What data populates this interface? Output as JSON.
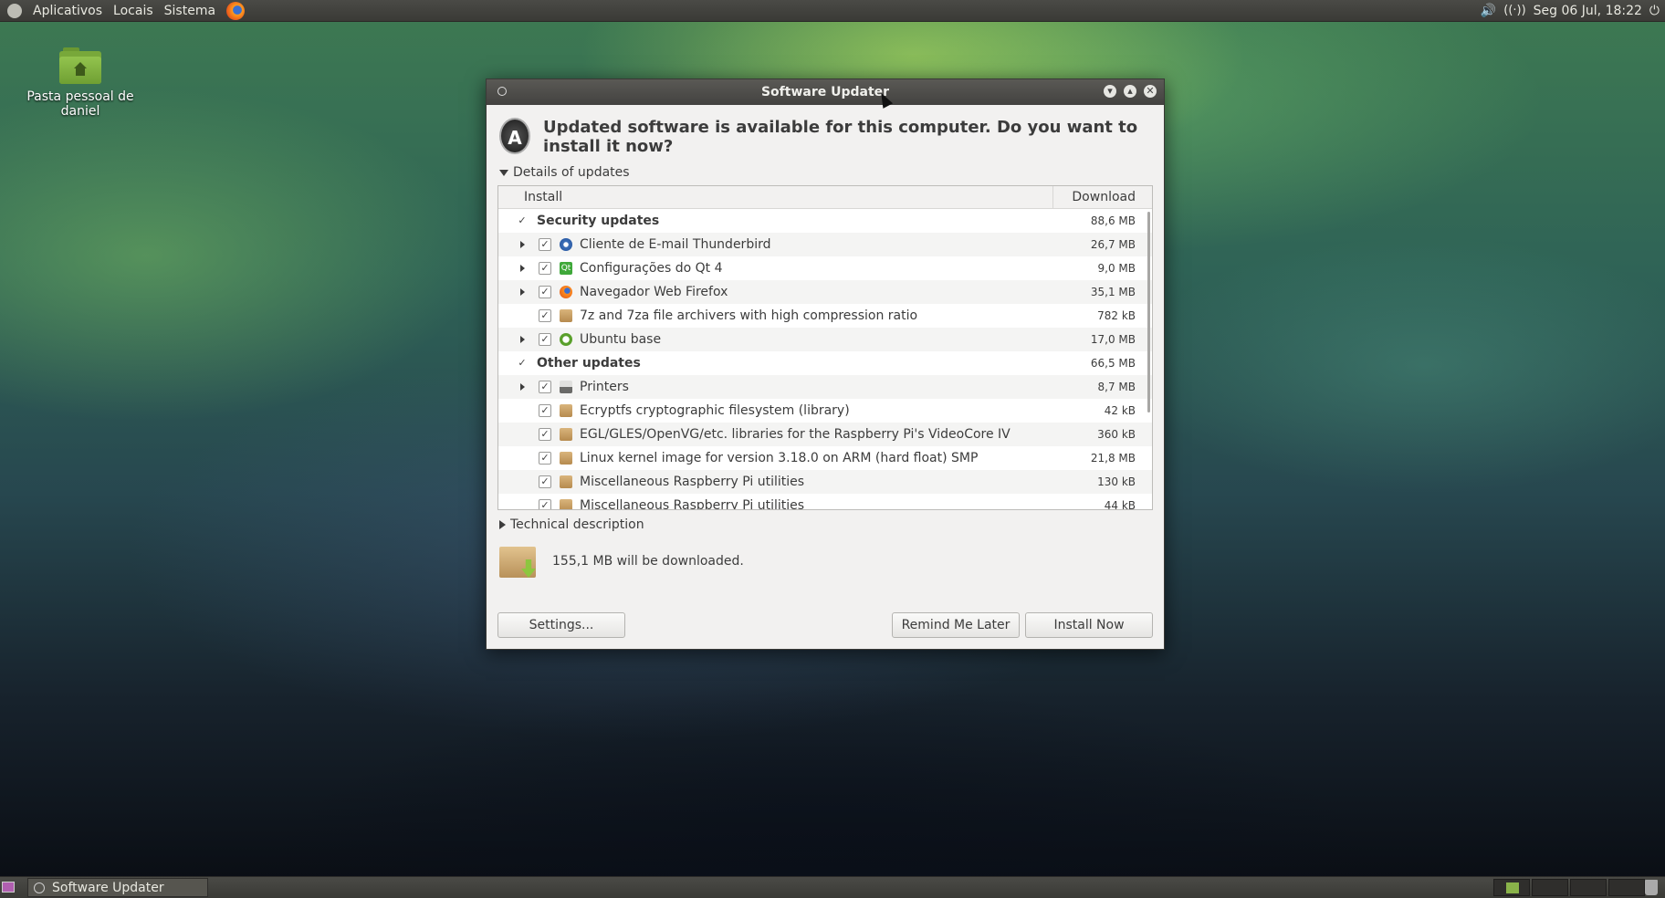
{
  "top_panel": {
    "menus": [
      "Aplicativos",
      "Locais",
      "Sistema"
    ],
    "clock": "Seg 06 Jul, 18:22"
  },
  "desktop": {
    "home_icon_label": "Pasta pessoal de daniel"
  },
  "window": {
    "title": "Software Updater",
    "headline": "Updated software is available for this computer. Do you want to install it now?",
    "details_label": "Details of updates",
    "columns": {
      "install": "Install",
      "download": "Download"
    },
    "rows": [
      {
        "kind": "category",
        "label": "Security updates",
        "size": "88,6 MB",
        "checked": true,
        "expandable": false,
        "icon": ""
      },
      {
        "kind": "item",
        "label": "Cliente de E-mail Thunderbird",
        "size": "26,7 MB",
        "checked": true,
        "expandable": true,
        "icon": "thunderbird-icon"
      },
      {
        "kind": "item",
        "label": "Configurações do Qt 4",
        "size": "9,0 MB",
        "checked": true,
        "expandable": true,
        "icon": "qt-icon"
      },
      {
        "kind": "item",
        "label": "Navegador Web Firefox",
        "size": "35,1 MB",
        "checked": true,
        "expandable": true,
        "icon": "firefox-icon"
      },
      {
        "kind": "item",
        "label": "7z and 7za file archivers with high compression ratio",
        "size": "782 kB",
        "checked": true,
        "expandable": false,
        "icon": "package-icon"
      },
      {
        "kind": "item",
        "label": "Ubuntu base",
        "size": "17,0 MB",
        "checked": true,
        "expandable": true,
        "icon": "ubuntu-icon"
      },
      {
        "kind": "category",
        "label": "Other updates",
        "size": "66,5 MB",
        "checked": true,
        "expandable": false,
        "icon": ""
      },
      {
        "kind": "item",
        "label": "Printers",
        "size": "8,7 MB",
        "checked": true,
        "expandable": true,
        "icon": "printer-icon"
      },
      {
        "kind": "item",
        "label": "Ecryptfs cryptographic filesystem (library)",
        "size": "42 kB",
        "checked": true,
        "expandable": false,
        "icon": "package-icon"
      },
      {
        "kind": "item",
        "label": "EGL/GLES/OpenVG/etc. libraries for the Raspberry Pi's VideoCore IV",
        "size": "360 kB",
        "checked": true,
        "expandable": false,
        "icon": "package-icon"
      },
      {
        "kind": "item",
        "label": "Linux kernel image for version 3.18.0 on ARM (hard float) SMP",
        "size": "21,8 MB",
        "checked": true,
        "expandable": false,
        "icon": "package-icon"
      },
      {
        "kind": "item",
        "label": "Miscellaneous Raspberry Pi utilities",
        "size": "130 kB",
        "checked": true,
        "expandable": false,
        "icon": "package-icon"
      },
      {
        "kind": "item",
        "label": "Miscellaneous Raspberry Pi utilities",
        "size": "44 kB",
        "checked": true,
        "expandable": false,
        "icon": "package-icon"
      }
    ],
    "technical_label": "Technical description",
    "download_summary": "155,1 MB will be downloaded.",
    "buttons": {
      "settings": "Settings...",
      "remind": "Remind Me Later",
      "install": "Install Now"
    }
  },
  "bottom_panel": {
    "task_label": "Software Updater"
  }
}
